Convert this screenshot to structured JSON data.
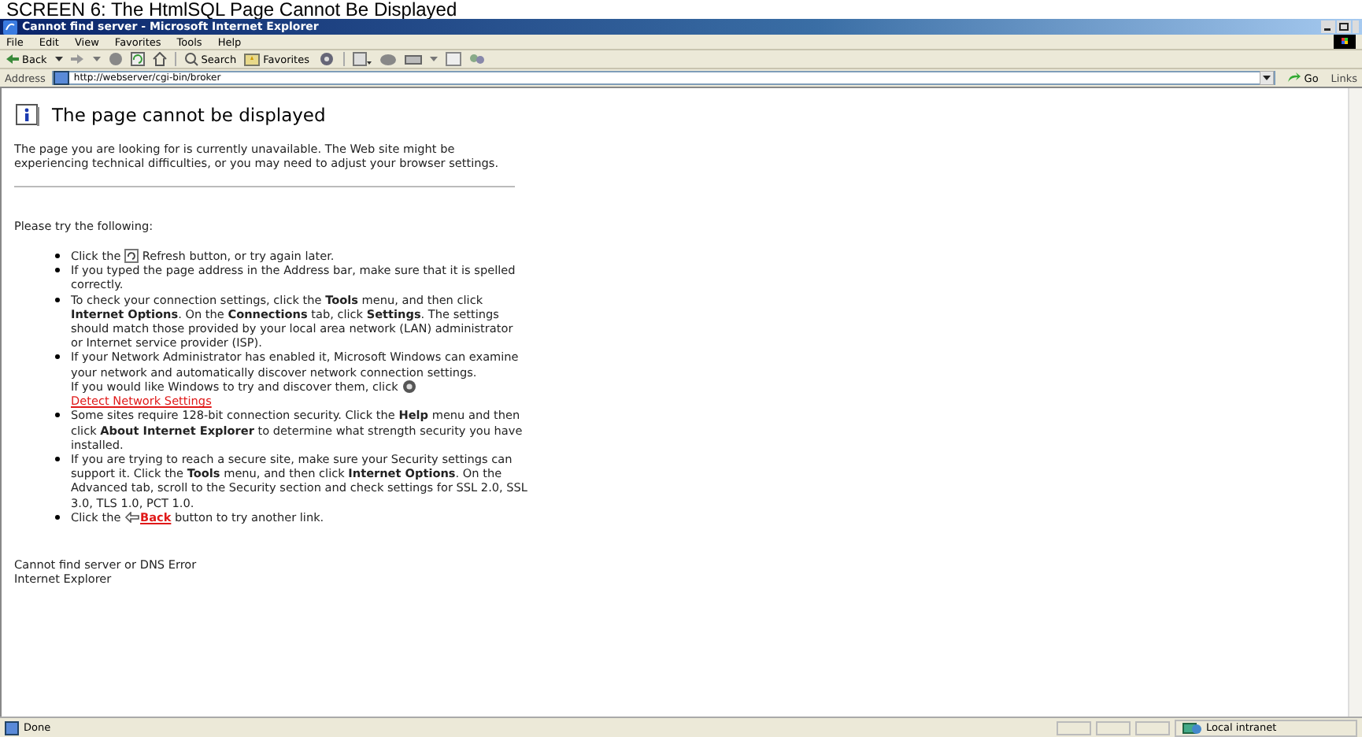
{
  "caption": "SCREEN 6:  The HtmlSQL Page Cannot Be Displayed",
  "window": {
    "title": "Cannot find server - Microsoft Internet Explorer"
  },
  "menu": [
    "File",
    "Edit",
    "View",
    "Favorites",
    "Tools",
    "Help"
  ],
  "toolbar": {
    "back": "Back",
    "search": "Search",
    "favorites": "Favorites"
  },
  "address": {
    "label": "Address",
    "value": "http://webserver/cgi-bin/broker",
    "go": "Go",
    "links": "Links"
  },
  "page": {
    "heading": "The page cannot be displayed",
    "intro": "The page you are looking for is currently unavailable. The Web site might be experiencing technical difficulties, or you may need to adjust your browser settings.",
    "try": "Please try the following:",
    "bullets": [
      [
        [
          {
            "kind": "text",
            "text": "Click the"
          },
          {
            "kind": "refresh"
          },
          {
            "kind": "text",
            "text": "Refresh button, or try again later."
          }
        ]
      ],
      [
        [
          {
            "kind": "text",
            "text": "If you typed the page address in the Address bar, make sure that it is spelled correctly."
          }
        ]
      ],
      [
        [
          {
            "kind": "text",
            "text": "To check your connection settings, click the **Tools** menu, and then click **Internet Options**. On the **Connections** tab, click **Settings**. The settings should match those provided by your local area network (LAN) administrator or Internet service provider (ISP)."
          }
        ]
      ],
      [
        [
          {
            "kind": "text",
            "text": "If your Network Administrator has enabled it, Microsoft Windows can examine your network and automatically discover network connection settings."
          }
        ],
        [
          {
            "kind": "text",
            "text": "If you would like Windows to try and discover them, click"
          },
          {
            "kind": "network-link",
            "text": "Detect Network Settings"
          }
        ]
      ],
      [
        [
          {
            "kind": "text",
            "text": "Some sites require 128-bit connection security. Click the **Help** menu and then click **About Internet Explorer** to determine what strength security you have installed."
          }
        ]
      ],
      [
        [
          {
            "kind": "text",
            "text": "If you are trying to reach a secure site, make sure your Security settings can support it. Click the **Tools** menu, and then click **Internet Options**. On the Advanced tab, scroll to the Security section and check settings for SSL 2.0, SSL 3.0, TLS 1.0, PCT 1.0."
          }
        ]
      ],
      [
        [
          {
            "kind": "text",
            "text": "Click the"
          },
          {
            "kind": "back-link",
            "text": "Back"
          },
          {
            "kind": "text",
            "text": "button to try another link."
          }
        ]
      ]
    ],
    "footer": [
      "Cannot find server or DNS Error",
      "Internet Explorer"
    ]
  },
  "status_bar": {
    "text": "Done",
    "zone": "Local intranet"
  }
}
